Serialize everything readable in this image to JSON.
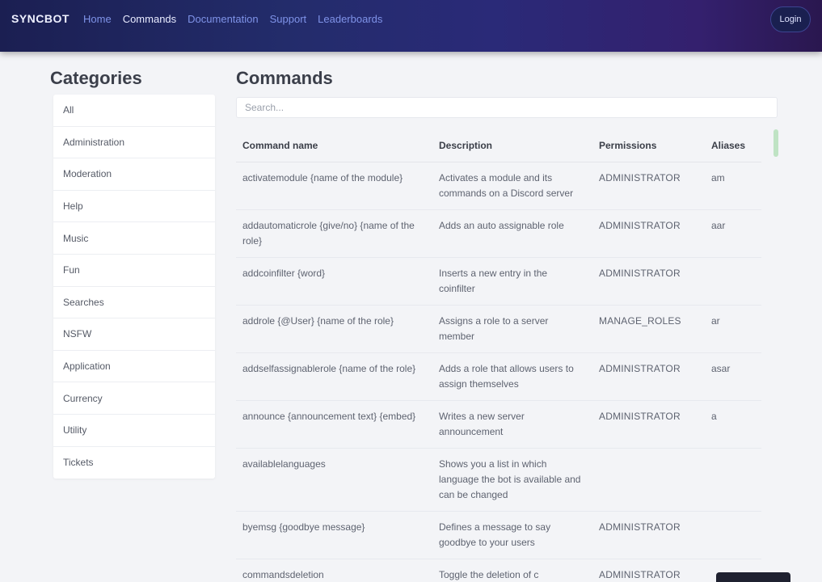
{
  "header": {
    "brand": "SYNCBOT",
    "nav": [
      "Home",
      "Commands",
      "Documentation",
      "Support",
      "Leaderboards"
    ],
    "login_label": "Login"
  },
  "sidebar": {
    "title": "Categories",
    "items": [
      "All",
      "Administration",
      "Moderation",
      "Help",
      "Music",
      "Fun",
      "Searches",
      "NSFW",
      "Application",
      "Currency",
      "Utility",
      "Tickets"
    ]
  },
  "main": {
    "title": "Commands",
    "search_placeholder": "Search...",
    "columns": [
      "Command name",
      "Description",
      "Permissions",
      "Aliases"
    ],
    "rows": [
      {
        "name": "activatemodule {name of the module}",
        "description": "Activates a module and its commands on a Discord server",
        "permissions": "ADMINISTRATOR",
        "aliases": "am"
      },
      {
        "name": "addautomaticrole {give/no} {name of the role}",
        "description": "Adds an auto assignable role",
        "permissions": "ADMINISTRATOR",
        "aliases": "aar"
      },
      {
        "name": "addcoinfilter {word}",
        "description": "Inserts a new entry in the coinfilter",
        "permissions": "ADMINISTRATOR",
        "aliases": ""
      },
      {
        "name": "addrole {@User} {name of the role}",
        "description": "Assigns a role to a server member",
        "permissions": "MANAGE_ROLES",
        "aliases": "ar"
      },
      {
        "name": "addselfassignablerole {name of the role}",
        "description": "Adds a role that allows users to assign themselves",
        "permissions": "ADMINISTRATOR",
        "aliases": "asar"
      },
      {
        "name": "announce {announcement text} {embed}",
        "description": "Writes a new server announcement",
        "permissions": "ADMINISTRATOR",
        "aliases": "a"
      },
      {
        "name": "availablelanguages",
        "description": "Shows you a list in which language the bot is available and can be changed",
        "permissions": "",
        "aliases": ""
      },
      {
        "name": "byemsg {goodbye message}",
        "description": "Defines a message to say goodbye to your users",
        "permissions": "ADMINISTRATOR",
        "aliases": ""
      },
      {
        "name": "commandsdeletion",
        "description": "Toggle the deletion of c",
        "permissions": "ADMINISTRATOR",
        "aliases": ""
      }
    ]
  }
}
